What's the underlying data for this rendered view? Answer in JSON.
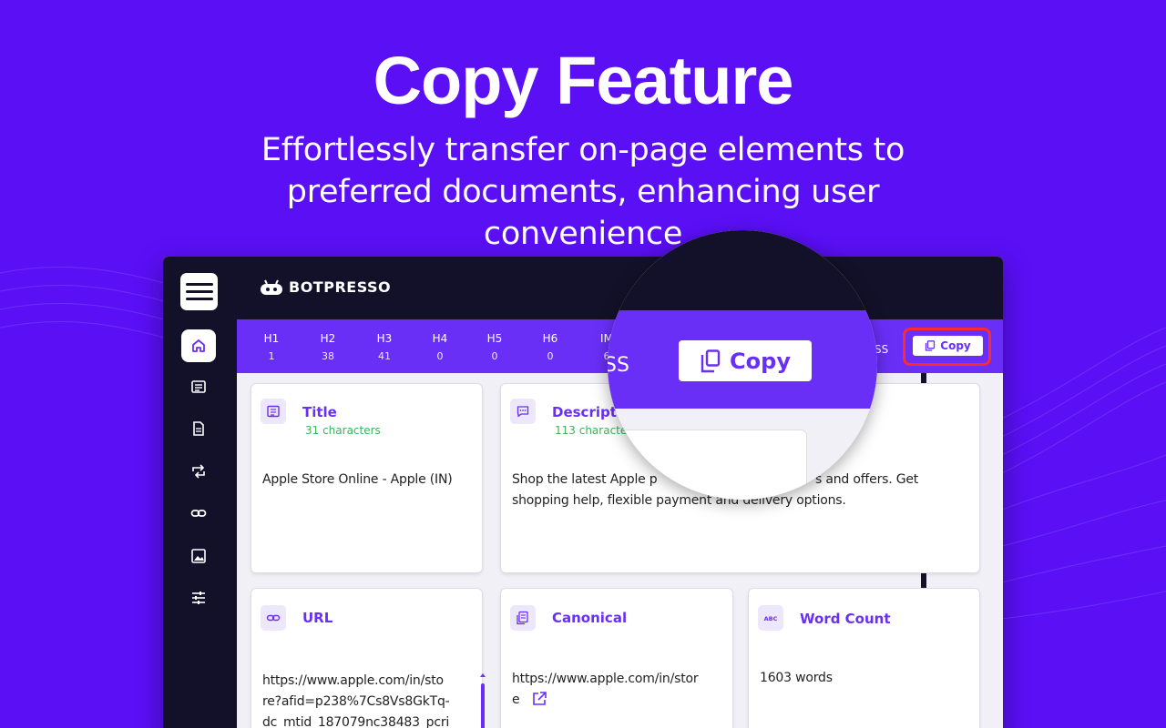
{
  "hero": {
    "title": "Copy Feature",
    "subtitle": "Effortlessly transfer on-page elements to preferred documents, enhancing user convenience"
  },
  "app": {
    "logo": "BOTPRESSO",
    "headings": [
      {
        "label": "H1",
        "value": "1"
      },
      {
        "label": "H2",
        "value": "38"
      },
      {
        "label": "H3",
        "value": "41"
      },
      {
        "label": "H4",
        "value": "0"
      },
      {
        "label": "H5",
        "value": "0"
      },
      {
        "label": "H6",
        "value": "0"
      },
      {
        "label": "IM",
        "value": "6"
      }
    ],
    "stat_ss": "SS",
    "copy_label": "Copy",
    "cards": {
      "title": {
        "label": "Title",
        "count": "31 characters",
        "value": "Apple Store Online - Apple (IN)"
      },
      "description": {
        "label": "Descripti",
        "count": "113 characte",
        "line1": "Shop the latest Apple p",
        "line1b": "s and offers. Get",
        "line2": "shopping help, flexible payment and delivery options."
      },
      "url": {
        "label": "URL",
        "line1": "https://www.apple.com/in/sto",
        "line1b": "re?afid=p238%7Cs8Vs8GkTq-",
        "line2": "dc_mtid_187079nc38483_pcri"
      },
      "canonical": {
        "label": "Canonical",
        "line1": "https://www.apple.com/in/stor",
        "line2": "e"
      },
      "wordcount": {
        "label": "Word Count",
        "value": "1603 words"
      }
    }
  },
  "magnifier": {
    "ss": "SS",
    "copy_label": "Copy"
  },
  "colors": {
    "background": "#5a0ff5",
    "dark": "#13112a",
    "accent": "#6a2ff7",
    "highlight": "#ff2a2a",
    "count_green": "#3cb25a"
  }
}
